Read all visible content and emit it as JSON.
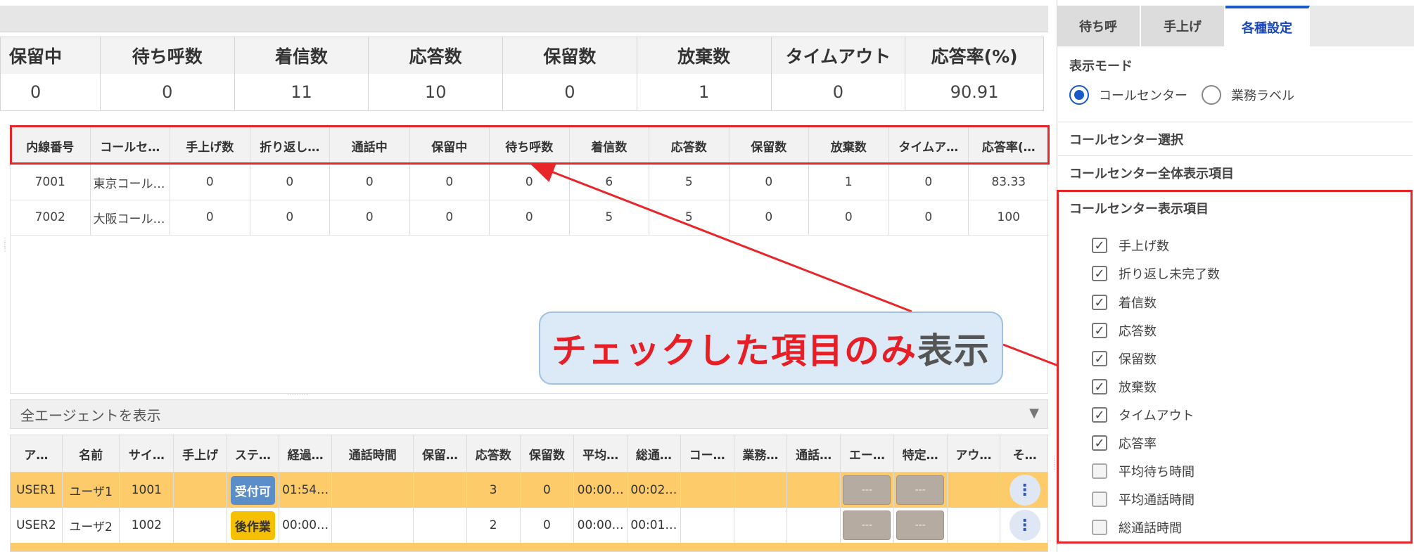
{
  "summary": {
    "headers": [
      "保留中",
      "待ち呼数",
      "着信数",
      "応答数",
      "保留数",
      "放棄数",
      "タイムアウト",
      "応答率(%)"
    ],
    "values": [
      "0",
      "0",
      "11",
      "10",
      "0",
      "1",
      "0",
      "90.91"
    ]
  },
  "cc_table": {
    "headers": [
      "内線番号",
      "コールセ…",
      "手上げ数",
      "折り返し…",
      "通話中",
      "保留中",
      "待ち呼数",
      "着信数",
      "応答数",
      "保留数",
      "放棄数",
      "タイムア…",
      "応答率(…"
    ],
    "rows": [
      [
        "7001",
        "東京コール…",
        "0",
        "0",
        "0",
        "0",
        "0",
        "6",
        "5",
        "0",
        "1",
        "0",
        "83.33"
      ],
      [
        "7002",
        "大阪コール…",
        "0",
        "0",
        "0",
        "0",
        "0",
        "5",
        "5",
        "0",
        "0",
        "0",
        "100"
      ]
    ]
  },
  "agent_filter": {
    "label": "全エージェントを表示"
  },
  "agent_table": {
    "headers": [
      "ア…",
      "名前",
      "サイ…",
      "手上げ",
      "ステ…",
      "経過…",
      "通話時間",
      "保留…",
      "応答数",
      "保留数",
      "平均…",
      "総通…",
      "コー…",
      "業務…",
      "通話…",
      "エー…",
      "特定…",
      "アウ…",
      "そ…"
    ],
    "rows": [
      {
        "id": "USER1",
        "name": "ユーザ1",
        "site": "1001",
        "status": "受付可",
        "elapsed": "01:54…",
        "answered": "3",
        "hold": "0",
        "avg": "00:00…",
        "total": "00:02…",
        "btn1": "---",
        "btn2": "---"
      },
      {
        "id": "USER2",
        "name": "ユーザ2",
        "site": "1002",
        "status": "後作業",
        "elapsed": "00:00…",
        "answered": "2",
        "hold": "0",
        "avg": "00:00…",
        "total": "00:01…",
        "btn1": "---",
        "btn2": "---"
      }
    ],
    "status_colors": {
      "受付可": "#5b8ec9",
      "後作業": "#f5c000"
    }
  },
  "tabs": [
    "待ち呼",
    "手上げ",
    "各種設定"
  ],
  "right_panel": {
    "mode_label": "表示モード",
    "mode_options": [
      "コールセンター",
      "業務ラベル"
    ],
    "mode_selected": "コールセンター",
    "sections": [
      "コールセンター選択",
      "コールセンター全体表示項目",
      "コールセンター表示項目"
    ],
    "display_items": [
      {
        "label": "手上げ数",
        "checked": true
      },
      {
        "label": "折り返し未完了数",
        "checked": true
      },
      {
        "label": "着信数",
        "checked": true
      },
      {
        "label": "応答数",
        "checked": true
      },
      {
        "label": "保留数",
        "checked": true
      },
      {
        "label": "放棄数",
        "checked": true
      },
      {
        "label": "タイムアウト",
        "checked": true
      },
      {
        "label": "応答率",
        "checked": true
      },
      {
        "label": "平均待ち時間",
        "checked": false
      },
      {
        "label": "平均通話時間",
        "checked": false
      },
      {
        "label": "総通話時間",
        "checked": false
      }
    ]
  },
  "callout": {
    "highlight": "チェックした項目のみ",
    "rest": "表示"
  },
  "colors": {
    "accent": "#1a5ac8",
    "annotation_red": "#e8262a",
    "row_highlight": "#fdcb69"
  },
  "icons": {
    "checkbox_checked": "check-icon",
    "dropdown": "triangle-down-icon",
    "more": "vertical-dots-icon"
  }
}
